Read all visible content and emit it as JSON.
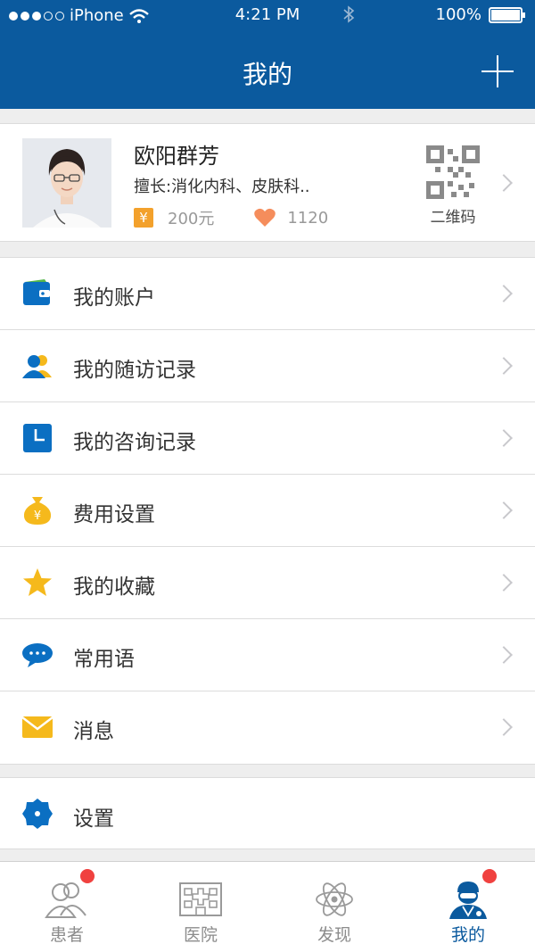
{
  "status_bar": {
    "carrier": "iPhone",
    "time": "4:21 PM",
    "battery": "100%"
  },
  "nav": {
    "title": "我的"
  },
  "profile": {
    "name": "欧阳群芳",
    "specialty": "擅长:消化内科、皮肤科..",
    "fee": "200元",
    "likes": "1120",
    "qr_label": "二维码"
  },
  "menu": {
    "items": [
      {
        "label": "我的账户",
        "icon": "wallet-icon"
      },
      {
        "label": "我的随访记录",
        "icon": "users-icon"
      },
      {
        "label": "我的咨询记录",
        "icon": "clock-icon"
      },
      {
        "label": "费用设置",
        "icon": "money-bag-icon"
      },
      {
        "label": "我的收藏",
        "icon": "star-icon"
      },
      {
        "label": "常用语",
        "icon": "chat-bubble-icon"
      },
      {
        "label": "消息",
        "icon": "envelope-icon"
      }
    ],
    "settings_label": "设置"
  },
  "tabbar": {
    "tabs": [
      {
        "label": "患者",
        "icon": "patients-icon"
      },
      {
        "label": "医院",
        "icon": "hospital-icon"
      },
      {
        "label": "发现",
        "icon": "atom-icon"
      },
      {
        "label": "我的",
        "icon": "doctor-icon"
      }
    ]
  },
  "colors": {
    "primary": "#0b5a9e",
    "accent": "#f3a12c",
    "badge": "#f0413f"
  }
}
